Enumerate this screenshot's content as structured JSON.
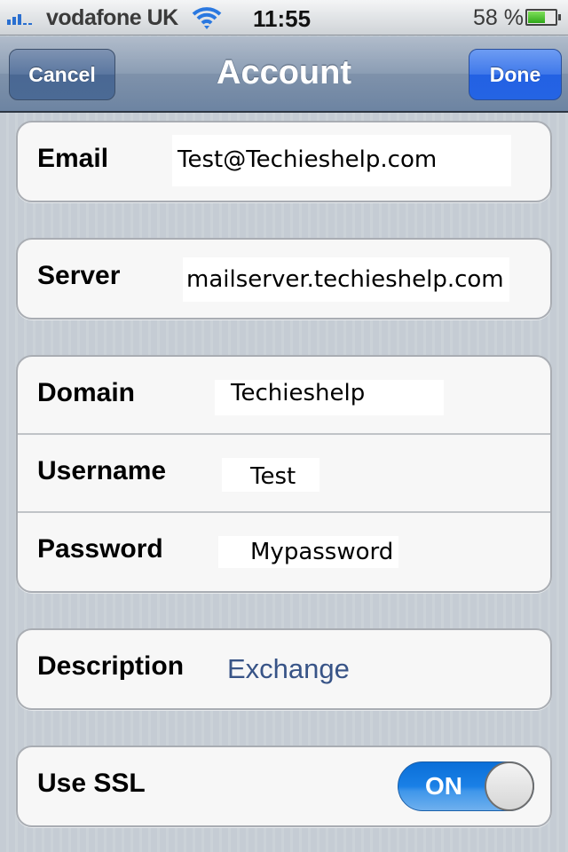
{
  "status_bar": {
    "signal_icon": "signal-bars-icon",
    "carrier": "vodafone UK",
    "wifi_icon": "wifi-icon",
    "time": "11:55",
    "battery_percent": "58 %",
    "battery_level": 0.58,
    "battery_icon": "battery-icon"
  },
  "nav_bar": {
    "title": "Account",
    "cancel_label": "Cancel",
    "done_label": "Done"
  },
  "form": {
    "email": {
      "label": "Email",
      "value": "Test@Techieshelp.com"
    },
    "server": {
      "label": "Server",
      "value": "mailserver.techieshelp.com"
    },
    "domain": {
      "label": "Domain",
      "value": "Techieshelp"
    },
    "username": {
      "label": "Username",
      "value": "Test"
    },
    "password": {
      "label": "Password",
      "value": "Mypassword"
    },
    "description": {
      "label": "Description",
      "value": "Exchange"
    },
    "use_ssl": {
      "label": "Use SSL",
      "state_label": "ON",
      "on": true
    }
  },
  "colors": {
    "done_button": "#2361e3",
    "cancel_button": "#4a6893",
    "toggle_on": "#1a80e6",
    "description_value": "#385487"
  }
}
